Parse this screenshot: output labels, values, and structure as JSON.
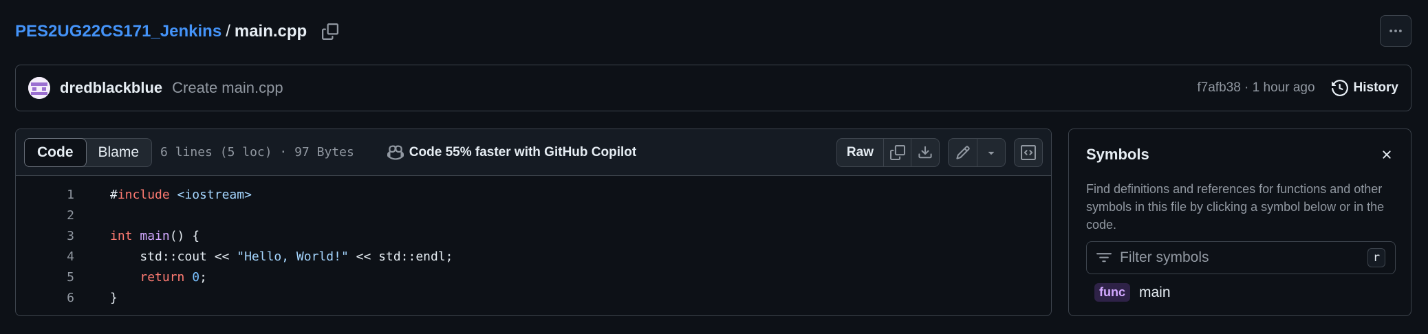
{
  "breadcrumb": {
    "repo": "PES2UG22CS171_Jenkins",
    "separator": "/",
    "file": "main.cpp"
  },
  "commit": {
    "author": "dredblackblue",
    "message": "Create main.cpp",
    "meta": "f7afb38 · 1 hour ago",
    "history_label": "History"
  },
  "toolbar": {
    "code_tab": "Code",
    "blame_tab": "Blame",
    "file_info": "6 lines (5 loc) · 97 Bytes",
    "copilot": "Code 55% faster with GitHub Copilot",
    "raw": "Raw"
  },
  "code": {
    "lines": [
      {
        "number": "1",
        "tokens": [
          {
            "t": "#",
            "c": ""
          },
          {
            "t": "include",
            "c": "kw"
          },
          {
            "t": " ",
            "c": ""
          },
          {
            "t": "<iostream>",
            "c": "inc"
          }
        ]
      },
      {
        "number": "2",
        "tokens": []
      },
      {
        "number": "3",
        "tokens": [
          {
            "t": "int",
            "c": "kw"
          },
          {
            "t": " ",
            "c": ""
          },
          {
            "t": "main",
            "c": "fn"
          },
          {
            "t": "() {",
            "c": ""
          }
        ]
      },
      {
        "number": "4",
        "tokens": [
          {
            "t": "    std::cout << ",
            "c": ""
          },
          {
            "t": "\"Hello, World!\"",
            "c": "str"
          },
          {
            "t": " << std::endl;",
            "c": ""
          }
        ]
      },
      {
        "number": "5",
        "tokens": [
          {
            "t": "    ",
            "c": ""
          },
          {
            "t": "return",
            "c": "kw"
          },
          {
            "t": " ",
            "c": ""
          },
          {
            "t": "0",
            "c": "num"
          },
          {
            "t": ";",
            "c": ""
          }
        ]
      },
      {
        "number": "6",
        "tokens": [
          {
            "t": "}",
            "c": ""
          }
        ]
      }
    ]
  },
  "symbols": {
    "title": "Symbols",
    "description": "Find definitions and references for functions and other symbols in this file by clicking a symbol below or in the code.",
    "filter_placeholder": "Filter symbols",
    "shortcut": "r",
    "items": [
      {
        "kind": "func",
        "name": "main"
      }
    ]
  },
  "icons": {
    "copy_path": "copy-icon",
    "more": "kebab-horizontal-icon",
    "history": "history-icon",
    "copilot": "copilot-icon",
    "copy_raw": "copy-icon",
    "download": "download-icon",
    "edit": "pencil-icon",
    "edit_menu": "triangle-down-icon",
    "symbols_toggle": "code-square-icon",
    "close": "x-icon",
    "filter": "filter-icon"
  },
  "colors": {
    "background": "#0d1117",
    "link": "#4493f8",
    "keyword": "#ff7b72",
    "string": "#a5d6ff",
    "function": "#d2a8ff",
    "number": "#79c0ff"
  }
}
